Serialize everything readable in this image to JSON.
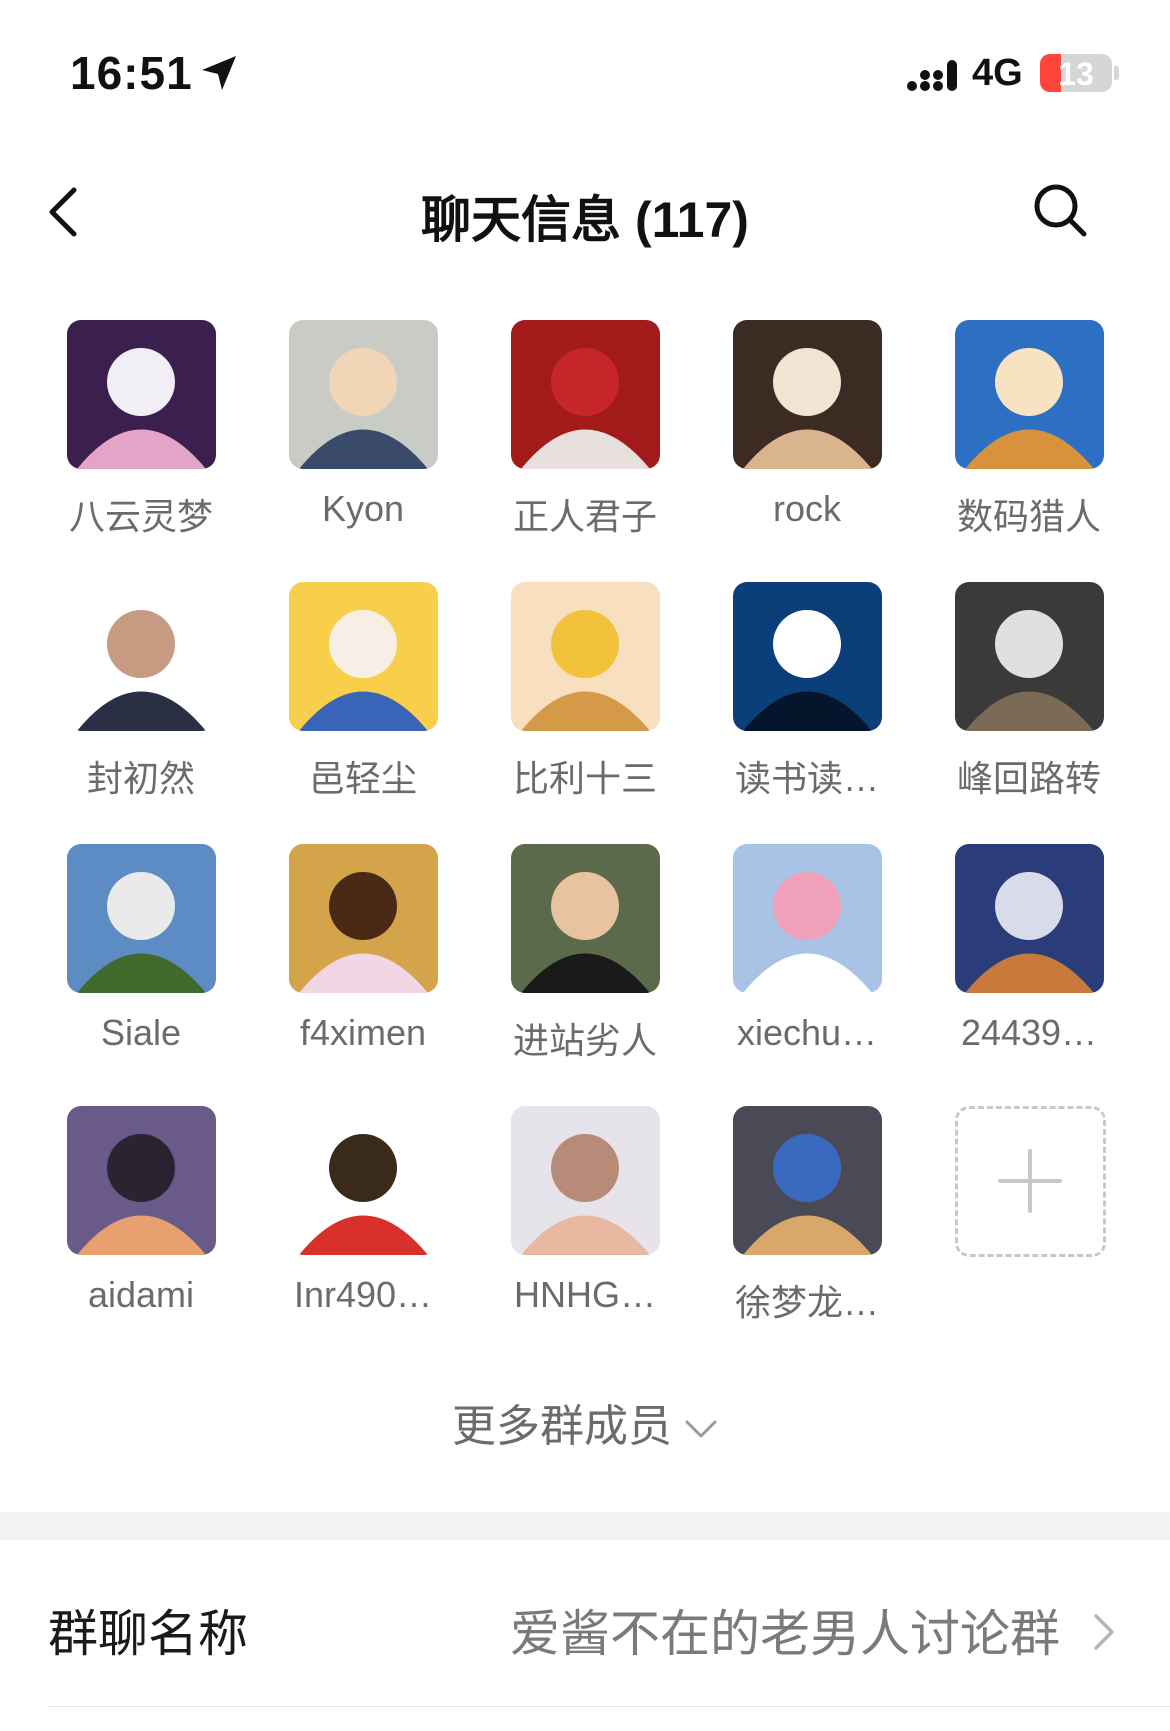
{
  "status_bar": {
    "time": "16:51",
    "network": "4G",
    "battery": "13",
    "battery_level": 0.13,
    "icons": [
      "location-arrow-icon",
      "signal-icon",
      "battery-icon"
    ]
  },
  "nav": {
    "title": "聊天信息 (117)",
    "icons": [
      "back-chevron-icon",
      "search-icon"
    ]
  },
  "members": [
    {
      "name": "八云灵梦",
      "colors": [
        "#3a1f4f",
        "#e4a4c8",
        "#f2eef6"
      ]
    },
    {
      "name": "Kyon",
      "colors": [
        "#c9ccc4",
        "#3a4a6a",
        "#f0d6b6"
      ]
    },
    {
      "name": "正人君子",
      "colors": [
        "#a31a1a",
        "#e8e0dc",
        "#c6262a"
      ]
    },
    {
      "name": "rock",
      "colors": [
        "#3b2b22",
        "#d9b58e",
        "#f2e4d2"
      ]
    },
    {
      "name": "数码猎人",
      "colors": [
        "#2d6fc2",
        "#d8913c",
        "#f7e3c2"
      ]
    },
    {
      "name": "封初然",
      "colors": [
        "#ffffff",
        "#2a2f44",
        "#c79a82"
      ]
    },
    {
      "name": "邑轻尘",
      "colors": [
        "#f8cf4a",
        "#3a64b8",
        "#f7efe6"
      ]
    },
    {
      "name": "比利十三",
      "colors": [
        "#f8dfbf",
        "#d49a48",
        "#f2c23a"
      ]
    },
    {
      "name": "读书读…",
      "colors": [
        "#0a3f7a",
        "#05152b",
        "#ffffff"
      ]
    },
    {
      "name": "峰回路转",
      "colors": [
        "#3a3a3a",
        "#7a6a56",
        "#e0e0e0"
      ]
    },
    {
      "name": "Siale",
      "colors": [
        "#5d8cc4",
        "#3f6a2c",
        "#eaeaea"
      ]
    },
    {
      "name": "f4ximen",
      "colors": [
        "#d4a44a",
        "#f1d6e4",
        "#4a2a16"
      ]
    },
    {
      "name": "进站劣人",
      "colors": [
        "#5b6a4a",
        "#1a1a1a",
        "#e8c3a0"
      ]
    },
    {
      "name": "xiechu…",
      "colors": [
        "#a8c3e6",
        "#ffffff",
        "#f0a0b8"
      ]
    },
    {
      "name": "24439…",
      "colors": [
        "#2a3c7a",
        "#c87a3c",
        "#d8dcea"
      ]
    },
    {
      "name": "aidami",
      "colors": [
        "#6a5a8a",
        "#e8a070",
        "#2a2430"
      ]
    },
    {
      "name": "Inr490…",
      "colors": [
        "#ffffff",
        "#d8302a",
        "#3a2a1a"
      ]
    },
    {
      "name": "HNHG…",
      "colors": [
        "#e6e4ea",
        "#e8b8a0",
        "#b88a78"
      ]
    },
    {
      "name": "徐梦龙…",
      "colors": [
        "#4a4a56",
        "#d8a86a",
        "#3a6ac0"
      ]
    }
  ],
  "add_member_icon": "plus-icon",
  "more_members": {
    "label": "更多群成员",
    "icon": "chevron-down-icon"
  },
  "group_name_row": {
    "label": "群聊名称",
    "value": "爱酱不在的老男人讨论群",
    "icon": "chevron-right-icon"
  }
}
